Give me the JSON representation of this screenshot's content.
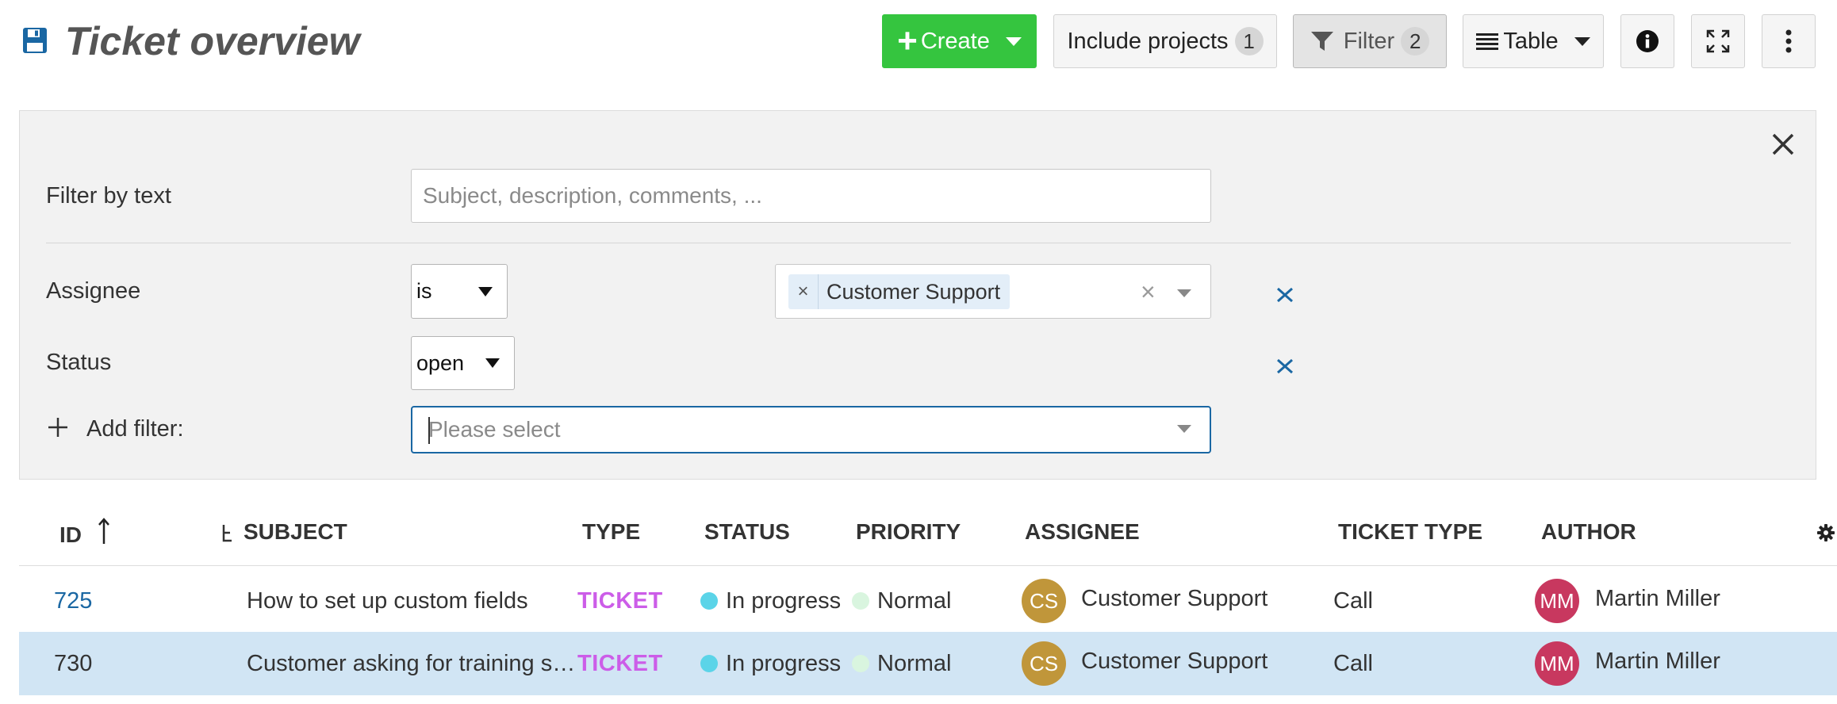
{
  "header": {
    "title": "Ticket overview",
    "icon": "save-icon"
  },
  "toolbar": {
    "create_label": "Create",
    "include_projects_label": "Include projects",
    "include_projects_count": "1",
    "filter_label": "Filter",
    "filter_count": "2",
    "table_label": "Table",
    "colors": {
      "create": "#35c53f"
    }
  },
  "filters": {
    "text_label": "Filter by text",
    "text_placeholder": "Subject, description, comments, ...",
    "assignee_label": "Assignee",
    "assignee_operator": "is",
    "assignee_values": [
      "Customer Support"
    ],
    "status_label": "Status",
    "status_operator": "open",
    "add_filter_label": "Add filter:",
    "add_filter_placeholder": "Please select"
  },
  "table": {
    "columns": [
      "ID",
      "SUBJECT",
      "TYPE",
      "STATUS",
      "PRIORITY",
      "ASSIGNEE",
      "TICKET TYPE",
      "AUTHOR"
    ],
    "sort": {
      "column": "ID",
      "direction": "ascending"
    },
    "rows": [
      {
        "id": "725",
        "subject": "How to set up custom fields",
        "type": "TICKET",
        "status": "In progress",
        "priority": "Normal",
        "assignee": "Customer Support",
        "assignee_initials": "CS",
        "ticket_type": "Call",
        "author": "Martin Miller",
        "author_initials": "MM",
        "selected": false
      },
      {
        "id": "730",
        "subject": "Customer asking for training s…",
        "type": "TICKET",
        "status": "In progress",
        "priority": "Normal",
        "assignee": "Customer Support",
        "assignee_initials": "CS",
        "ticket_type": "Call",
        "author": "Martin Miller",
        "author_initials": "MM",
        "selected": true
      }
    ],
    "colors": {
      "type": "#cc5de8",
      "status_in_progress": "#5bd4e8",
      "priority_normal": "#d9f5df",
      "assignee_avatar": "#c0963a",
      "author_avatar": "#c8385f",
      "selected_row": "#d1e5f4",
      "link": "#1a67a3"
    }
  }
}
